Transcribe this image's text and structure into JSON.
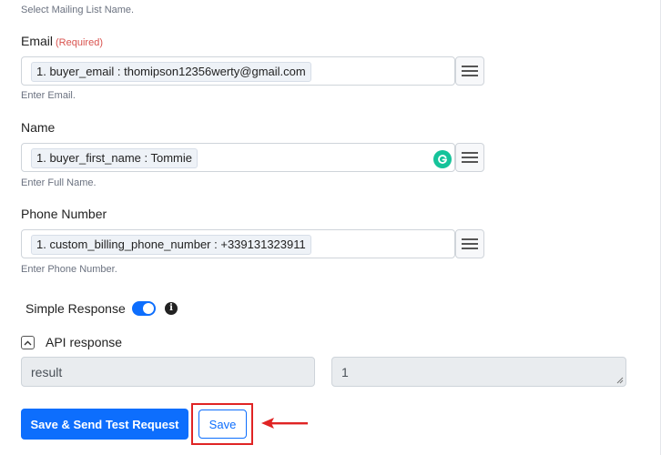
{
  "mailing_list": {
    "hint": "Select Mailing List Name."
  },
  "email": {
    "label": "Email",
    "required": "(Required)",
    "value": "1. buyer_email : thomipson12356werty@gmail.com",
    "hint": "Enter Email."
  },
  "name": {
    "label": "Name",
    "value": "1. buyer_first_name : Tommie",
    "hint": "Enter Full Name."
  },
  "phone": {
    "label": "Phone Number",
    "value": "1. custom_billing_phone_number : +339131323911",
    "hint": "Enter Phone Number."
  },
  "simple_response": {
    "label": "Simple Response",
    "enabled": true
  },
  "api_response": {
    "label": "API response",
    "key_value": "result",
    "val_value": "1"
  },
  "buttons": {
    "save_send": "Save & Send Test Request",
    "save": "Save"
  },
  "colors": {
    "primary": "#0d6efd",
    "required": "#d9534f",
    "highlight": "#e02424",
    "grammarly": "#15c39a"
  },
  "icons": {
    "menu": "hamburger-menu-icon",
    "grammarly": "grammarly-icon",
    "info": "info-icon",
    "collapse": "chevron-up-icon",
    "arrow": "left-arrow-icon"
  }
}
